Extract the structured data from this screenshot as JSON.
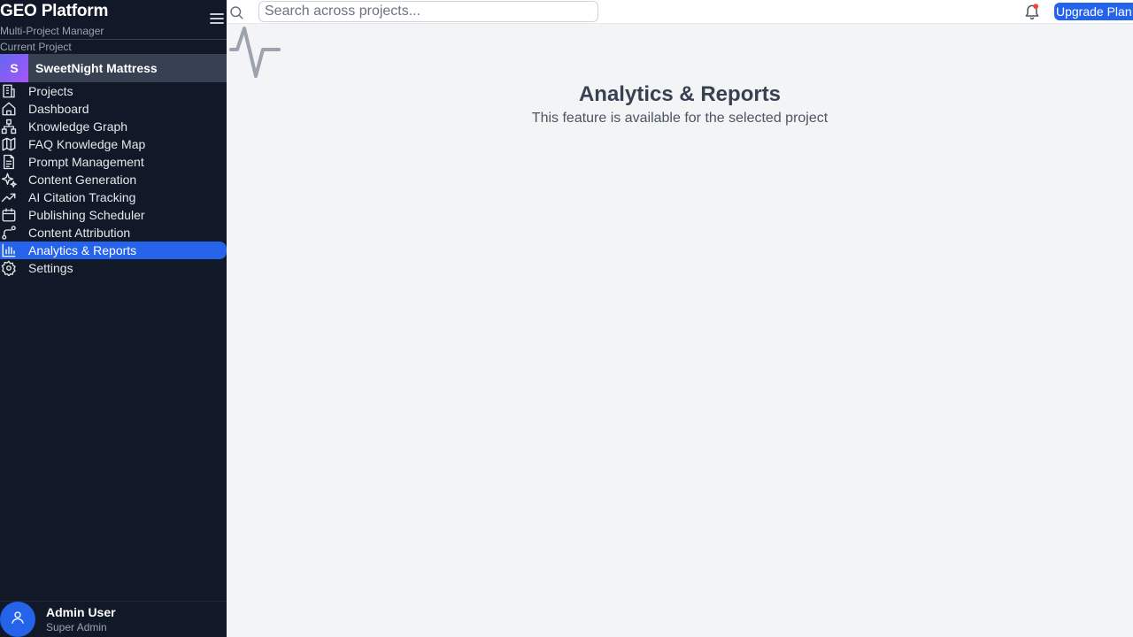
{
  "sidebar": {
    "brand": "GEO Platform",
    "subtitle": "Multi-Project Manager",
    "current_project_label": "Current Project",
    "project": {
      "initial": "S",
      "name": "SweetNight Mattress"
    },
    "items": [
      {
        "label": "Projects",
        "icon": "building-icon"
      },
      {
        "label": "Dashboard",
        "icon": "home-icon"
      },
      {
        "label": "Knowledge Graph",
        "icon": "network-icon"
      },
      {
        "label": "FAQ Knowledge Map",
        "icon": "map-icon"
      },
      {
        "label": "Prompt Management",
        "icon": "document-icon"
      },
      {
        "label": "Content Generation",
        "icon": "sparkles-icon"
      },
      {
        "label": "AI Citation Tracking",
        "icon": "trending-up-icon"
      },
      {
        "label": "Publishing Scheduler",
        "icon": "calendar-icon"
      },
      {
        "label": "Content Attribution",
        "icon": "route-icon"
      },
      {
        "label": "Analytics & Reports",
        "icon": "bar-chart-icon",
        "active": true
      },
      {
        "label": "Settings",
        "icon": "gear-icon"
      }
    ],
    "user": {
      "name": "Admin User",
      "role": "Super Admin"
    }
  },
  "topbar": {
    "search_placeholder": "Search across projects...",
    "upgrade_label": "Upgrade Plan"
  },
  "main": {
    "title": "Analytics & Reports",
    "description": "This feature is available for the selected project"
  },
  "colors": {
    "sidebar_bg": "#111827",
    "accent": "#2563eb",
    "notification": "#ef4444"
  }
}
